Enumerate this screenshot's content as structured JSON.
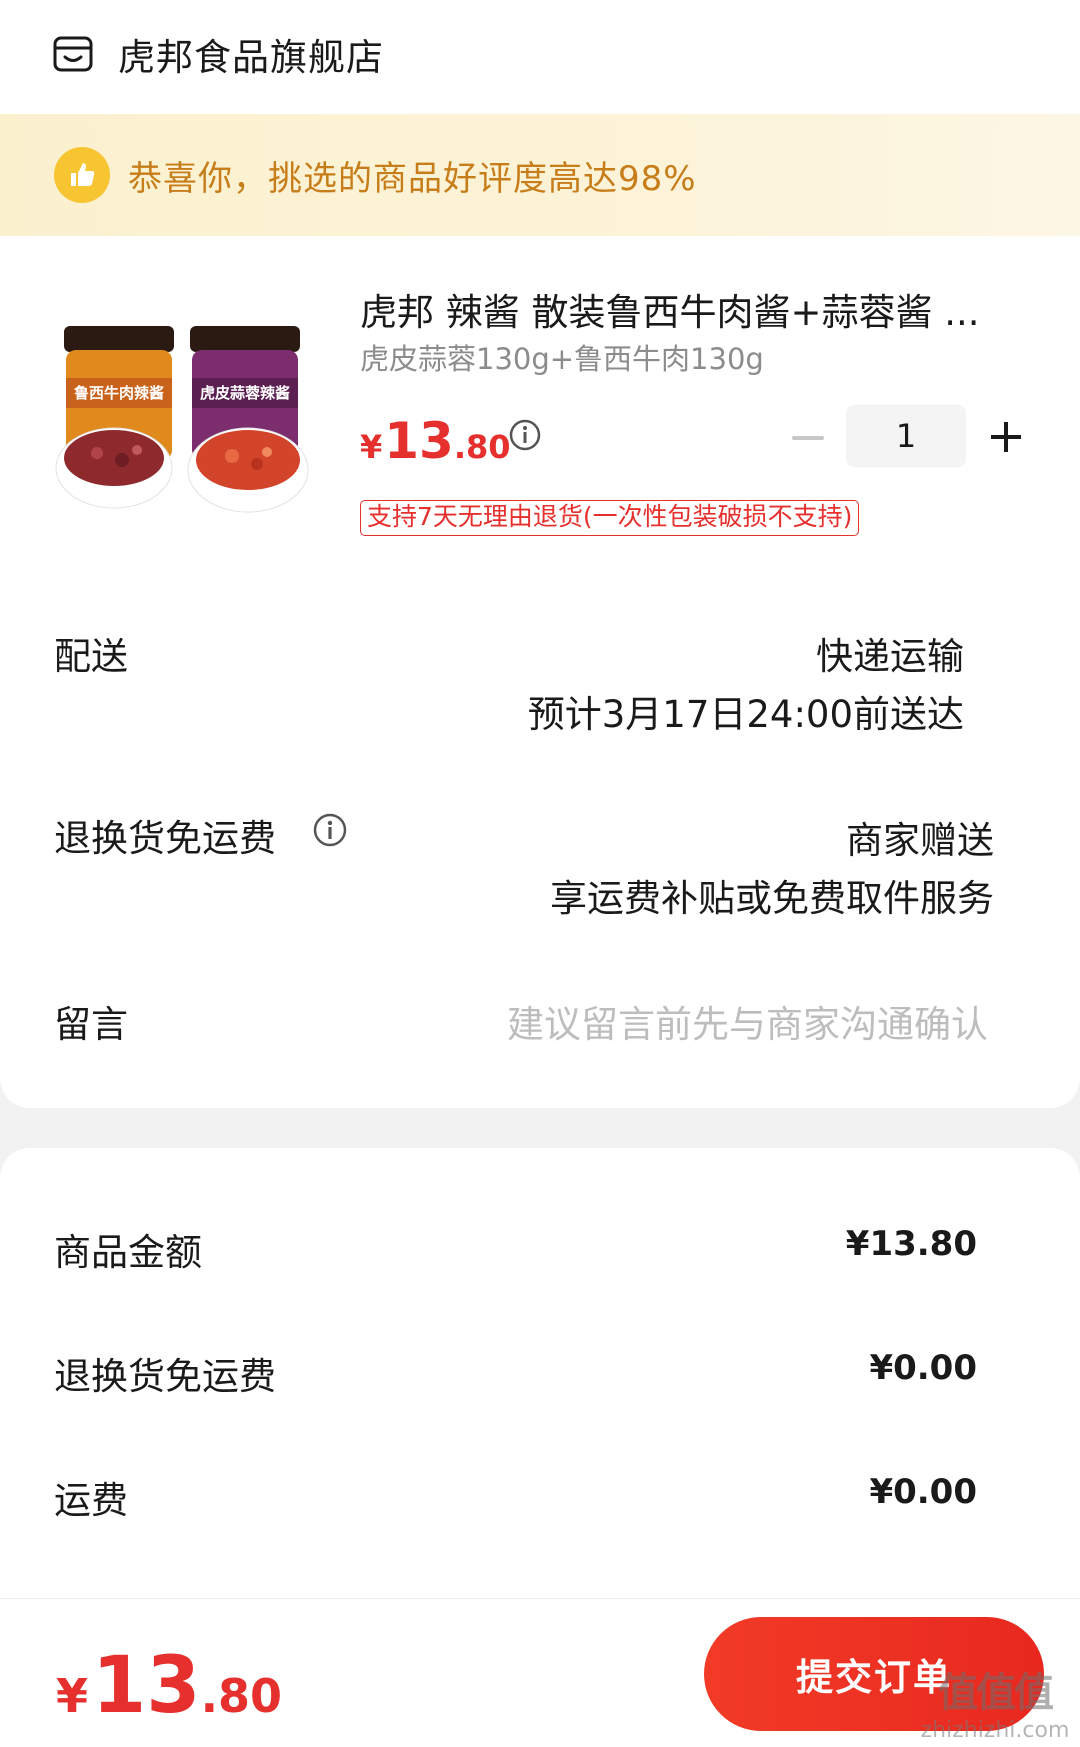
{
  "store": {
    "name": "虎邦食品旗舰店",
    "icon": "store-icon"
  },
  "banner": {
    "icon": "thumbs-up-icon",
    "text": "恭喜你，挑选的商品好评度高达98%"
  },
  "product": {
    "title": "虎邦 辣酱  散装鲁西牛肉酱+蒜蓉酱 ...",
    "spec": "虎皮蒜蓉130g+鲁西牛肉130g",
    "price_symbol": "¥",
    "price_int": "13",
    "price_dec": ".80",
    "quantity": "1",
    "return_tag": "支持7天无理由退货(一次性包装破损不支持)",
    "image_labels": [
      "鲁西牛肉辣酱",
      "虎皮蒜蓉辣酱"
    ]
  },
  "delivery": {
    "label": "配送",
    "method": "快递运输",
    "eta": "预计3月17日24:00前送达"
  },
  "return_shipping": {
    "label": "退换货免运费",
    "value": "商家赠送",
    "desc": "享运费补贴或免费取件服务"
  },
  "message": {
    "label": "留言",
    "placeholder": "建议留言前先与商家沟通确认"
  },
  "summary": {
    "items": [
      {
        "label": "商品金额",
        "value": "¥13.80"
      },
      {
        "label": "退换货免运费",
        "value": "¥0.00"
      },
      {
        "label": "运费",
        "value": "¥0.00"
      }
    ]
  },
  "footer": {
    "total_symbol": "¥",
    "total_int": "13",
    "total_dec": ".80",
    "submit_label": "提交订单"
  },
  "watermark": {
    "big": "值值值",
    "small": "zhizhizhi.com"
  },
  "colors": {
    "accent": "#e5302d",
    "banner_text": "#c77d1a",
    "banner_bg": "#fbf1cf"
  }
}
